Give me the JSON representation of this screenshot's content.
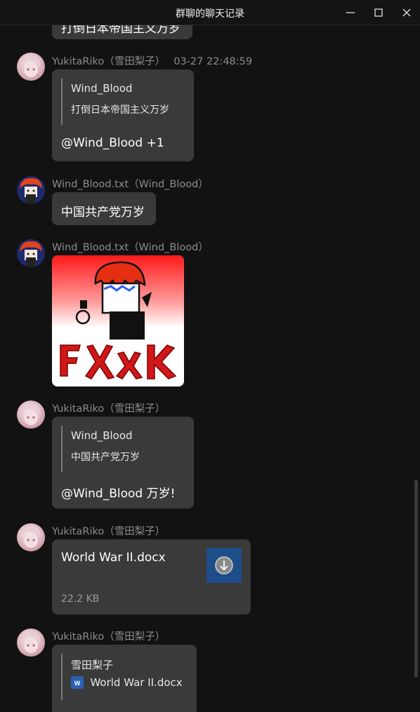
{
  "window": {
    "title": "群聊的聊天记录"
  },
  "colors": {
    "background": "#121212",
    "bubble": "#3a3a3a",
    "sender_text": "#8c8c8c",
    "file_icon_bg": "#1d4e89",
    "word_icon_bg": "#2b5fb4"
  },
  "top_partial": {
    "text": "打倒日本帝国主义万岁"
  },
  "messages": [
    {
      "sender": "YukitaRiko（雪田梨子）",
      "time": "03-27 22:48:59",
      "quote_name": "Wind_Blood",
      "quote_text": "打倒日本帝国主义万岁",
      "text": "@Wind_Blood +1"
    },
    {
      "sender": "Wind_Blood.txt（Wind_Blood）",
      "text": "中国共产党万岁"
    },
    {
      "sender": "Wind_Blood.txt（Wind_Blood）",
      "sticker_text": "FXXK"
    },
    {
      "sender": "YukitaRiko（雪田梨子）",
      "quote_name": "Wind_Blood",
      "quote_text": "中国共产党万岁",
      "text": "@Wind_Blood 万岁!"
    },
    {
      "sender": "YukitaRiko（雪田梨子）",
      "file_name": "World War II.docx",
      "file_size": "22.2 KB",
      "file_icon": "download-icon"
    },
    {
      "sender": "YukitaRiko（雪田梨子）",
      "quote_name": "雪田梨子",
      "quote_file": "World War II.docx",
      "quote_file_icon": "word-doc-icon"
    }
  ]
}
